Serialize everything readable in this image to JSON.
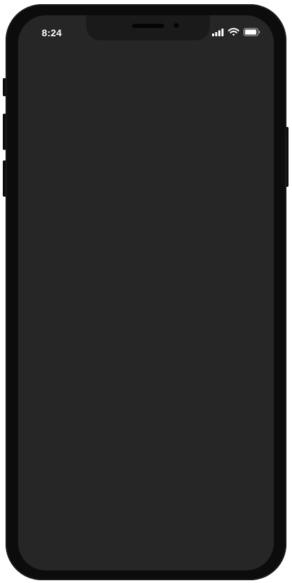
{
  "status_bar": {
    "time": "8:24",
    "icons": [
      "cellular-signal-icon",
      "wifi-icon",
      "battery-icon"
    ],
    "battery_level": 0.95
  },
  "colors": {
    "screen": "#262626",
    "bezel": "#0c0c0c",
    "status_text": "#ffffff"
  }
}
